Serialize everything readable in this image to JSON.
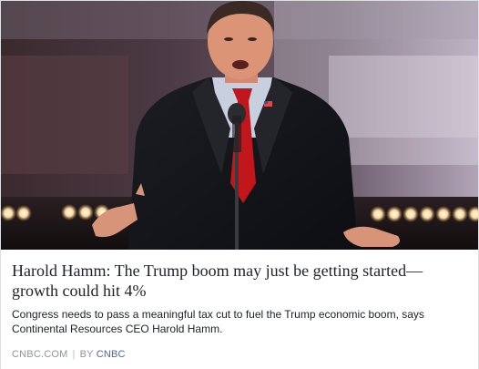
{
  "article": {
    "headline": "Harold Hamm: The Trump boom may just be getting started—growth could hit 4%",
    "description": "Congress needs to pass a meaningful tax cut to fuel the Trump economic boom, says Continental Resources CEO Harold Hamm.",
    "source": "CNBC.COM",
    "separator": "|",
    "by_label": "BY",
    "author": "CNBC"
  },
  "image": {
    "subject": "man speaking at podium with microphone"
  }
}
